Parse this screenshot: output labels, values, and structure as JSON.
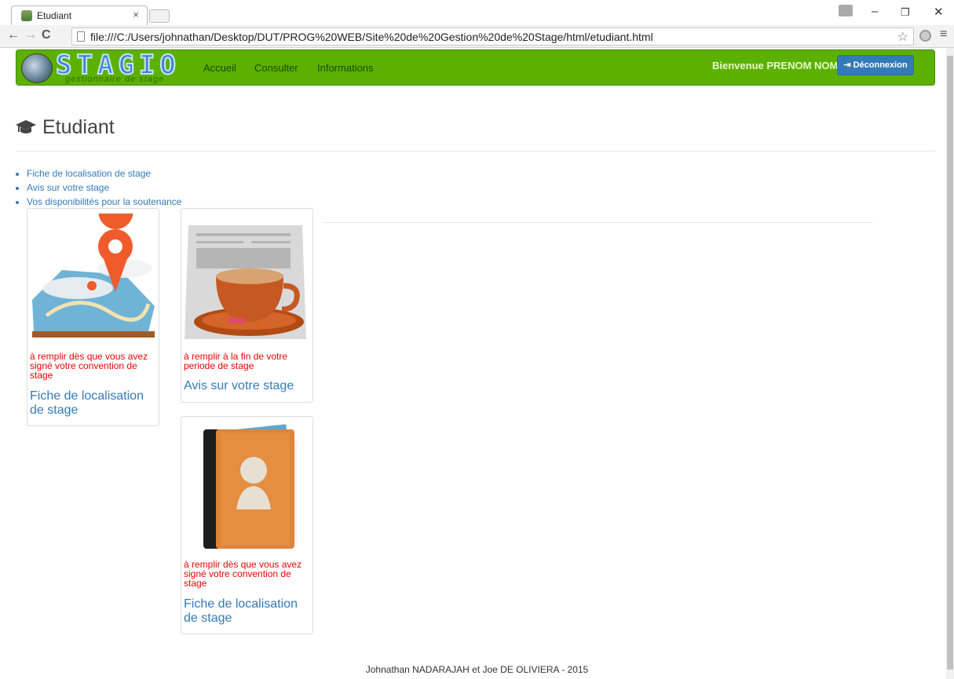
{
  "browser": {
    "tab_title": "Etudiant",
    "tab_close": "×",
    "url": "file:///C:/Users/johnathan/Desktop/DUT/PROG%20WEB/Site%20de%20Gestion%20de%20Stage/html/etudiant.html",
    "minimize": "–",
    "restore": "❐",
    "close": "✕",
    "back": "←",
    "forward": "→",
    "reload": "C",
    "star": "☆",
    "menu": "≡"
  },
  "navbar": {
    "brand": "STAGIO",
    "tagline": "gestionnaire de stage",
    "links": [
      "Accueil",
      "Consulter",
      "Informations"
    ],
    "welcome": "Bienvenue PRENOM NOM",
    "logout": "Déconnexion",
    "logout_icon": "sign-out-icon",
    "color": "#5cb100"
  },
  "page": {
    "title": "Etudiant",
    "title_icon": "graduation-cap-icon",
    "links": [
      "Fiche de localisation de stage",
      "Avis sur votre stage",
      "Vos disponibilités pour la soutenance"
    ]
  },
  "cards": [
    {
      "hint": "à remplir dès que vous avez signé votre convention de stage",
      "title": "Fiche de localisation de stage",
      "icon": "map-pin-icon"
    },
    {
      "hint": "à remplir à la fin de votre periode de stage",
      "title": "Avis sur votre stage",
      "icon": "coffee-newspaper-icon"
    },
    {
      "hint": "à remplir dès que vous avez signé votre convention de stage",
      "title": "Fiche de localisation de stage",
      "icon": "address-book-icon"
    }
  ],
  "footer": "Johnathan NADARAJAH et Joe DE OLIVIERA - 2015"
}
